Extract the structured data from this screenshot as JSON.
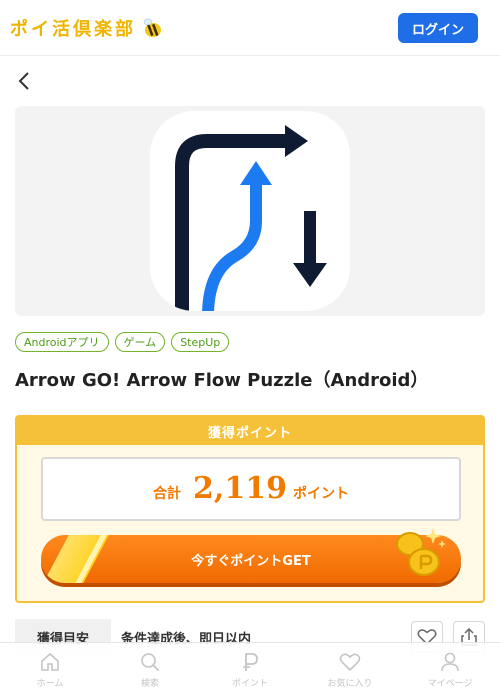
{
  "header": {
    "logo_text": "ポイ活倶楽部",
    "login_label": "ログイン"
  },
  "tags": [
    "Androidアプリ",
    "ゲーム",
    "StepUp"
  ],
  "offer": {
    "title": "Arrow GO! Arrow Flow Puzzle（Android）"
  },
  "points": {
    "heading": "獲得ポイント",
    "total_label": "合計",
    "total_value": "2,119",
    "total_unit": "ポイント",
    "cta_label": "今すぐポイントGET"
  },
  "guide": {
    "label": "獲得目安",
    "value": "条件達成後、即日以内"
  },
  "bottom_nav": [
    {
      "label": "ホーム",
      "icon": "home-icon"
    },
    {
      "label": "検索",
      "icon": "search-icon"
    },
    {
      "label": "ポイント",
      "icon": "point-icon"
    },
    {
      "label": "お気に入り",
      "icon": "heart-icon"
    },
    {
      "label": "マイページ",
      "icon": "user-icon"
    }
  ],
  "colors": {
    "brand_yellow": "#f0b400",
    "login_blue": "#1f6ee8",
    "tag_green": "#74b42a",
    "points_orange": "#f07b00",
    "box_gold": "#f3c038"
  }
}
